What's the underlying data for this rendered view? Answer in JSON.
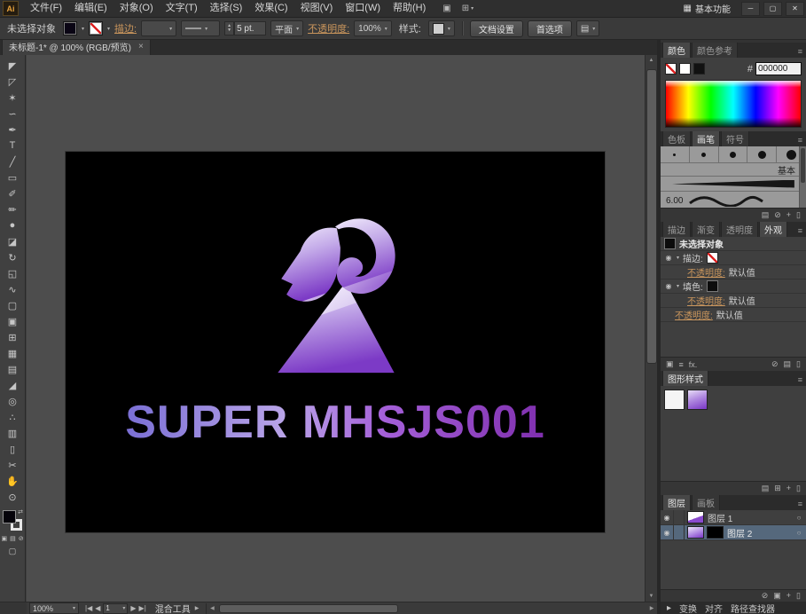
{
  "colors": {
    "accent_link": "#c9955c",
    "layer_selected_row": "#55687c",
    "logo_purple": "#7c3ac6",
    "logo_lavender": "#f0eafb",
    "artboard_background": "#000000"
  },
  "icons": {
    "caret_down": "▾",
    "panel_menu": "≡",
    "eye": "◉",
    "target": "○",
    "trash": "▯",
    "new_item": "+",
    "grid": "⊞",
    "list": "▤",
    "none": "⊘",
    "squares": "▣",
    "expand": "▾",
    "collapsed": "▸",
    "up": "▲",
    "down": "▼",
    "left": "◀",
    "right": "▶",
    "first": "|◀",
    "last": "▶|",
    "swap": "⇄",
    "screen_mode": "▢",
    "workspace_grid": "▦",
    "arrange_docs": "▣"
  },
  "menubar": {
    "app_logo": "Ai",
    "menus": [
      "文件(F)",
      "编辑(E)",
      "对象(O)",
      "文字(T)",
      "选择(S)",
      "效果(C)",
      "视图(V)",
      "窗口(W)",
      "帮助(H)"
    ],
    "workspace": "基本功能",
    "window_buttons": {
      "minimize": "─",
      "maximize": "▢",
      "close": "✕"
    }
  },
  "controlbar": {
    "no_selection": "未选择对象",
    "stroke_link": "描边:",
    "stroke_weight": "5 pt.",
    "brush_name": "平面",
    "opacity_link": "不透明度:",
    "opacity_value": "100%",
    "style_label": "样式:",
    "document_setup": "文档设置",
    "preferences": "首选项"
  },
  "tabbar": {
    "document_title": "未标题-1* @ 100% (RGB/预览)",
    "close": "×"
  },
  "tools": [
    {
      "name": "selection",
      "glyph": "◤"
    },
    {
      "name": "direct-selection",
      "glyph": "◸"
    },
    {
      "name": "magic-wand",
      "glyph": "✶"
    },
    {
      "name": "lasso",
      "glyph": "∽"
    },
    {
      "name": "pen",
      "glyph": "✒"
    },
    {
      "name": "type",
      "glyph": "T"
    },
    {
      "name": "line-segment",
      "glyph": "╱"
    },
    {
      "name": "rectangle",
      "glyph": "▭"
    },
    {
      "name": "paintbrush",
      "glyph": "✐"
    },
    {
      "name": "pencil",
      "glyph": "✏"
    },
    {
      "name": "blob-brush",
      "glyph": "●"
    },
    {
      "name": "eraser",
      "glyph": "◪"
    },
    {
      "name": "rotate",
      "glyph": "↻"
    },
    {
      "name": "scale",
      "glyph": "◱"
    },
    {
      "name": "width",
      "glyph": "∿"
    },
    {
      "name": "free-transform",
      "glyph": "▢"
    },
    {
      "name": "shape-builder",
      "glyph": "▣"
    },
    {
      "name": "perspective-grid",
      "glyph": "⊞"
    },
    {
      "name": "mesh",
      "glyph": "▦"
    },
    {
      "name": "gradient",
      "glyph": "▤"
    },
    {
      "name": "eyedropper",
      "glyph": "◢"
    },
    {
      "name": "blend",
      "glyph": "◎"
    },
    {
      "name": "symbol-sprayer",
      "glyph": "∴"
    },
    {
      "name": "column-graph",
      "glyph": "▥"
    },
    {
      "name": "artboard",
      "glyph": "▯"
    },
    {
      "name": "slice",
      "glyph": "✂"
    },
    {
      "name": "hand",
      "glyph": "✋"
    },
    {
      "name": "zoom",
      "glyph": "⊙"
    }
  ],
  "canvas": {
    "logo_text": "SUPER MHSJS001"
  },
  "panels": {
    "color": {
      "tabs": [
        "颜色",
        "颜色参考"
      ],
      "hex_label": "#",
      "hex_value": "000000"
    },
    "brushes": {
      "tabs": [
        "色板",
        "画笔",
        "符号"
      ],
      "basic_label": "基本",
      "size_label": "6.00"
    },
    "appearance": {
      "tabs": [
        "描边",
        "渐变",
        "透明度",
        "外观"
      ],
      "no_selection": "未选择对象",
      "stroke_label": "描边:",
      "fill_label": "填色:",
      "opacity_label": "不透明度:",
      "default_value": "默认值",
      "fx_label": "fx."
    },
    "graphic_styles": {
      "tab": "图形样式"
    },
    "layers": {
      "tabs": [
        "图层",
        "画板"
      ],
      "rows": [
        {
          "name": "图层 1"
        },
        {
          "name": "图层 2"
        }
      ]
    },
    "dock_bottom_tabs": [
      "变换",
      "对齐",
      "路径查找器"
    ]
  },
  "statusbar": {
    "zoom": "100%",
    "artboard": "1",
    "tool_status": "混合工具"
  }
}
